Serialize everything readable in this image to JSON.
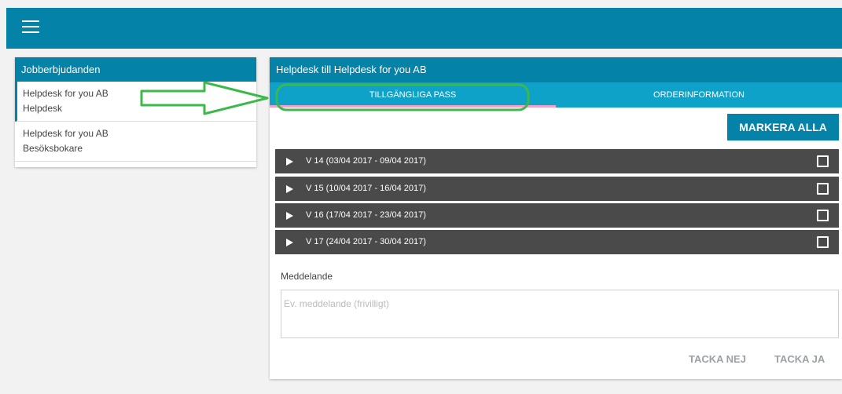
{
  "topbar": {
    "menu_icon": "hamburger-menu-icon",
    "color": "#0582a8"
  },
  "left_panel": {
    "title": "Jobberbjudanden",
    "items": [
      {
        "company": "Helpdesk for you AB",
        "role": "Helpdesk",
        "active": true
      },
      {
        "company": "Helpdesk for you AB",
        "role": "Besöksbokare",
        "active": false
      }
    ]
  },
  "main_panel": {
    "title": "Helpdesk till Helpdesk for you AB",
    "tabs": [
      {
        "label": "TILLGÄNGLIGA PASS",
        "active": true
      },
      {
        "label": "ORDERINFORMATION",
        "active": false
      }
    ],
    "mark_all_label": "MARKERA ALLA",
    "weeks": [
      {
        "label": "V 14 (03/04 2017 - 09/04 2017)",
        "checked": false
      },
      {
        "label": "V 15 (10/04 2017 - 16/04 2017)",
        "checked": false
      },
      {
        "label": "V 16 (17/04 2017 - 23/04 2017)",
        "checked": false
      },
      {
        "label": "V 17 (24/04 2017 - 30/04 2017)",
        "checked": false
      }
    ],
    "message_label": "Meddelande",
    "message_placeholder": "Ev. meddelande (frivilligt)",
    "message_value": "",
    "decline_label": "TACKA NEJ",
    "accept_label": "TACKA JA"
  },
  "colors": {
    "primary": "#0582a8",
    "tab_bar": "#0ea2c8",
    "week_row": "#4a4a4a",
    "tab_indicator": "#f5a0c8",
    "annotation": "#3db84a"
  }
}
